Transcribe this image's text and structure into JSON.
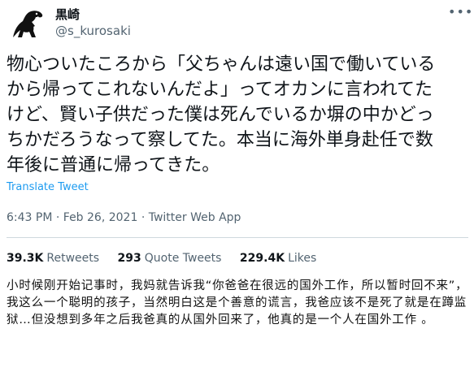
{
  "author": {
    "display_name": "黒崎",
    "handle": "@s_kurosaki",
    "avatar_icon": "dinosaur-avatar-icon",
    "more_icon": "more-options-icon"
  },
  "tweet": {
    "text": "物心ついたころから「父ちゃんは遠い国で働いている\nから帰ってこれないんだよ」ってオカンに言われてた\nけど、賢い子供だった僕は死んでいるか塀の中かどっ\nちかだろうなって察してた。本当に海外単身赴任で数\n年後に普通に帰ってきた。",
    "translate_label": "Translate Tweet",
    "time": "6:43 PM",
    "date": "Feb 26, 2021",
    "source": "Twitter Web App",
    "separator": "·"
  },
  "stats": {
    "retweets_count": "39.3K",
    "retweets_label": "Retweets",
    "quotes_count": "293",
    "quotes_label": "Quote Tweets",
    "likes_count": "229.4K",
    "likes_label": "Likes"
  },
  "caption": "小时候刚开始记事时，我妈就告诉我“你爸爸在很远的国外工作，所以暂时回不来”，我这么一个聪明的孩子，当然明白这是个善意的谎言，我爸应该不是死了就是在蹲监狱…但没想到多年之后我爸真的从国外回来了，他真的是一个人在国外工作 。",
  "colors": {
    "link": "#1d9bf0",
    "secondary_text": "#536471",
    "divider": "#cfd9de"
  }
}
